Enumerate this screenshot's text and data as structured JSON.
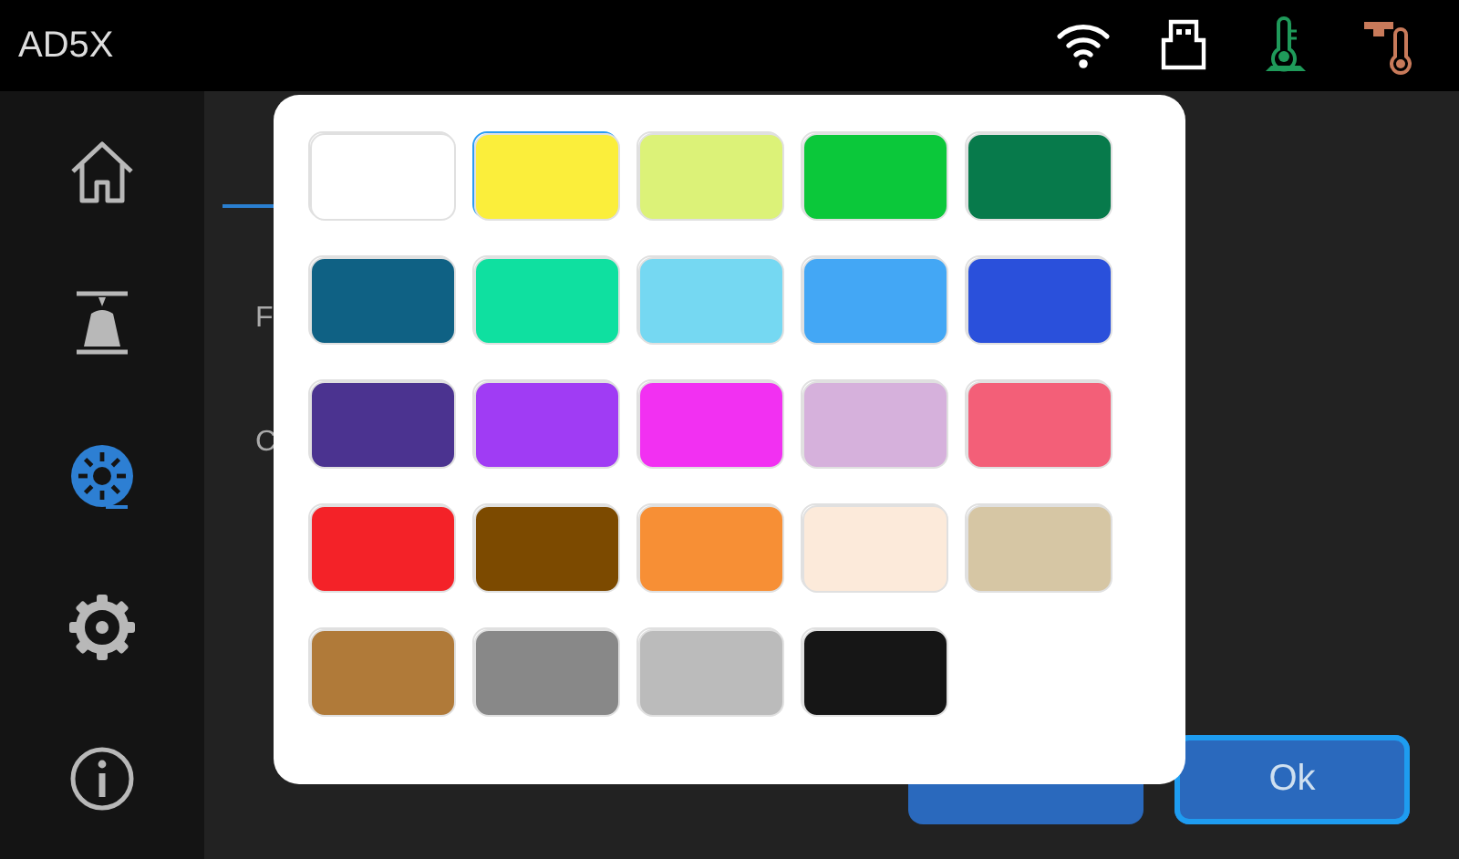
{
  "top_bar": {
    "title": "AD5X",
    "status_icons": [
      {
        "kind": "wifi"
      },
      {
        "kind": "usb"
      },
      {
        "kind": "bed_temp"
      },
      {
        "kind": "nozzle_temp"
      }
    ]
  },
  "sidebar": {
    "items": [
      {
        "kind": "home",
        "selected": false
      },
      {
        "kind": "print",
        "selected": false
      },
      {
        "kind": "filament",
        "selected": true
      },
      {
        "kind": "settings",
        "selected": false
      },
      {
        "kind": "info",
        "selected": false
      }
    ]
  },
  "content": {
    "rows": [
      {
        "label": "F"
      },
      {
        "label": "C"
      }
    ]
  },
  "buttons": [
    {
      "focused": false
    },
    {
      "label": "Ok",
      "focused": true
    }
  ],
  "color_picker": {
    "swatches": [
      {
        "color": "#ffffff",
        "selected": false
      },
      {
        "color": "#fbee3b",
        "selected": true
      },
      {
        "color": "#dcf278",
        "selected": false
      },
      {
        "color": "#0bc83a",
        "selected": false
      },
      {
        "color": "#077a4b",
        "selected": false
      },
      {
        "color": "#0f6184",
        "selected": false
      },
      {
        "color": "#0fe0a0",
        "selected": false
      },
      {
        "color": "#75d8f2",
        "selected": false
      },
      {
        "color": "#43a7f5",
        "selected": false
      },
      {
        "color": "#2a50db",
        "selected": false
      },
      {
        "color": "#4b3390",
        "selected": false
      },
      {
        "color": "#a03cf4",
        "selected": false
      },
      {
        "color": "#f230f2",
        "selected": false
      },
      {
        "color": "#d6b1dc",
        "selected": false
      },
      {
        "color": "#f35f78",
        "selected": false
      },
      {
        "color": "#f42228",
        "selected": false
      },
      {
        "color": "#7c4a00",
        "selected": false
      },
      {
        "color": "#f78f35",
        "selected": false
      },
      {
        "color": "#fceada",
        "selected": false
      },
      {
        "color": "#d6c6a4",
        "selected": false
      },
      {
        "color": "#b07a39",
        "selected": false
      },
      {
        "color": "#888888",
        "selected": false
      },
      {
        "color": "#bbbbbb",
        "selected": false
      },
      {
        "color": "#161616",
        "selected": false
      }
    ]
  }
}
